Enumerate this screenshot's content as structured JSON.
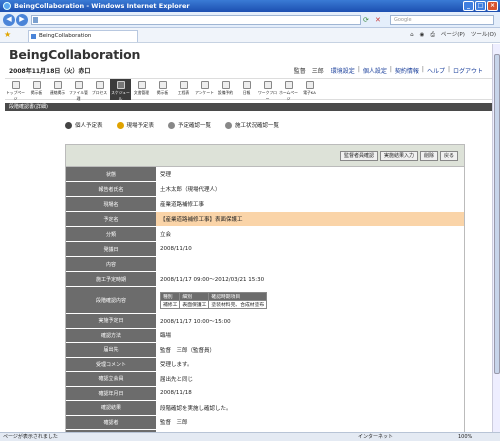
{
  "window": {
    "title": "BeingCollaboration - Windows Internet Explorer"
  },
  "browser": {
    "search_placeholder": "Google",
    "tab_label": "BeingCollaboration",
    "tools": [
      "ページ(P)",
      "ツール(O)"
    ]
  },
  "header": {
    "logo": "BeingCollaboration",
    "date": "2008年11月18日（火）赤口",
    "user": "監督　三郎",
    "links": [
      "環境設定",
      "個人設定",
      "契約情報",
      "ヘルプ",
      "ログアウト"
    ]
  },
  "menu": [
    {
      "label": "トップページ",
      "active": false
    },
    {
      "label": "掲示板",
      "active": false
    },
    {
      "label": "連絡掲示",
      "active": false
    },
    {
      "label": "ファイル管理",
      "active": false
    },
    {
      "label": "プロセス",
      "active": false
    },
    {
      "label": "スケジュール",
      "active": true
    },
    {
      "label": "文書管理",
      "active": false
    },
    {
      "label": "掲示板",
      "active": false
    },
    {
      "label": "工程表",
      "active": false
    },
    {
      "label": "アンケート",
      "active": false
    },
    {
      "label": "設備予約",
      "active": false
    },
    {
      "label": "日報",
      "active": false
    },
    {
      "label": "ワークフロー",
      "active": false
    },
    {
      "label": "ホームページ",
      "active": false
    },
    {
      "label": "電子KA",
      "active": false
    }
  ],
  "section": {
    "title": "段階確認書(詳細)"
  },
  "subnav": [
    {
      "label": "個人予定表",
      "color": "#444"
    },
    {
      "label": "現場予定表",
      "color": "#e0a300"
    },
    {
      "label": "予定確認一覧",
      "color": "#888"
    },
    {
      "label": "施工状況確認一覧",
      "color": "#888"
    }
  ],
  "actions": [
    "監督者員確認",
    "実施結果入力",
    "削除",
    "戻る"
  ],
  "rows": [
    {
      "label": "状態",
      "value": "受理"
    },
    {
      "label": "報告者氏名",
      "value": "土木太郎（現場代理人）"
    },
    {
      "label": "現場名",
      "value": "産業道路補修工事"
    },
    {
      "label": "予定名",
      "value": "【産業道路補修工事】表面保護工",
      "highlight": true
    },
    {
      "label": "分類",
      "value": "立会"
    },
    {
      "label": "発議日",
      "value": "2008/11/10"
    },
    {
      "label": "内容",
      "value": ""
    },
    {
      "label": "施工予定時期",
      "value": "2008/11/17 09:00～2012/03/21 15:30"
    }
  ],
  "inspection": {
    "label": "段階確認内容",
    "headers": [
      "種別",
      "細別",
      "確認時期項目"
    ],
    "cells": [
      "補修工",
      "表面保護工",
      "塗装材料完、合成材塗布"
    ]
  },
  "rows2": [
    {
      "label": "実施予定日",
      "value": "2008/11/17 10:00～15:00"
    },
    {
      "label": "確認方法",
      "value": "臨場"
    },
    {
      "label": "届出先",
      "value": "監督　三郎（監督員）"
    },
    {
      "label": "受理コメント",
      "value": "受理します。"
    },
    {
      "label": "確認立会員",
      "value": "届出先と同じ"
    },
    {
      "label": "確認年月日",
      "value": "2008/11/18"
    },
    {
      "label": "確認結果",
      "value": "段階確認を実施し確認した。"
    },
    {
      "label": "確認者",
      "value": "監督　三郎"
    },
    {
      "label": "確認実行監督職員",
      "value": "主任　監次郎(主任監督員)"
    }
  ],
  "status": {
    "left": "ページが表示されました",
    "zone": "インターネット",
    "zoom": "100%"
  }
}
